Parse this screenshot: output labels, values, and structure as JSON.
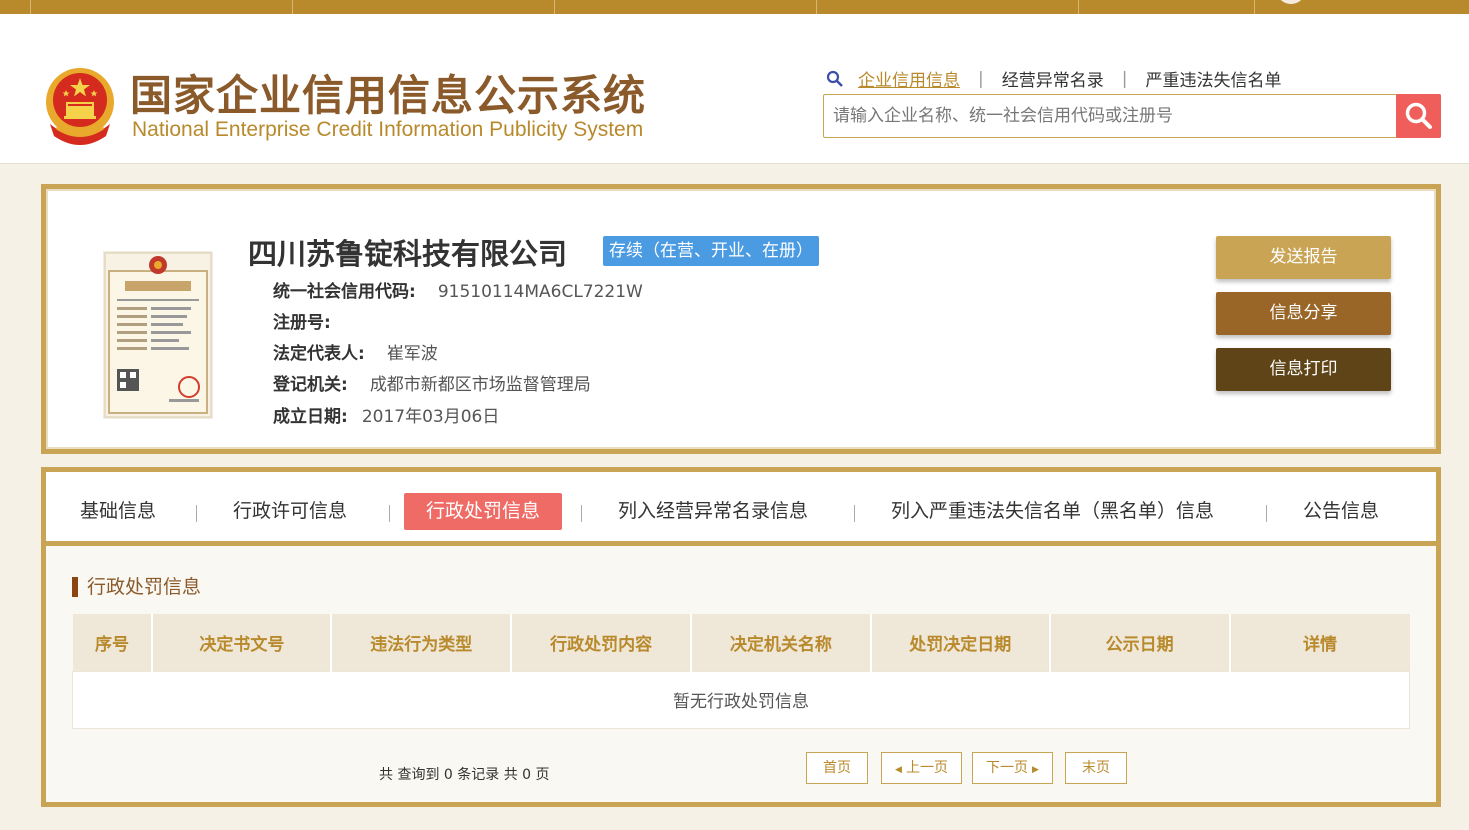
{
  "header": {
    "title_cn": "国家企业信用信息公示系统",
    "title_en": "National Enterprise Credit Information Publicity System",
    "search_links": [
      "企业信用信息",
      "经营异常名录",
      "严重违法失信名单"
    ],
    "search_placeholder": "请输入企业名称、统一社会信用代码或注册号"
  },
  "company": {
    "name": "四川苏鲁锭科技有限公司",
    "status": "存续（在营、开业、在册）",
    "credit_code_label": "统一社会信用代码:",
    "credit_code": "91510114MA6CL7221W",
    "reg_no_label": "注册号:",
    "reg_no": "",
    "legal_rep_label": "法定代表人:",
    "legal_rep": "崔军波",
    "authority_label": "登记机关:",
    "authority": "成都市新都区市场监督管理局",
    "founded_label": "成立日期:",
    "founded": "2017年03月06日"
  },
  "actions": {
    "send": "发送报告",
    "share": "信息分享",
    "print": "信息打印"
  },
  "tabs": [
    "基础信息",
    "行政许可信息",
    "行政处罚信息",
    "列入经营异常名录信息",
    "列入严重违法失信名单（黑名单）信息",
    "公告信息"
  ],
  "section": {
    "title": "行政处罚信息",
    "columns": [
      "序号",
      "决定书文号",
      "违法行为类型",
      "行政处罚内容",
      "决定机关名称",
      "处罚决定日期",
      "公示日期",
      "详情"
    ],
    "empty": "暂无行政处罚信息"
  },
  "pager": {
    "info": "共 查询到 0 条记录 共 0 页",
    "first": "首页",
    "prev": "上一页",
    "next": "下一页",
    "last": "末页"
  }
}
